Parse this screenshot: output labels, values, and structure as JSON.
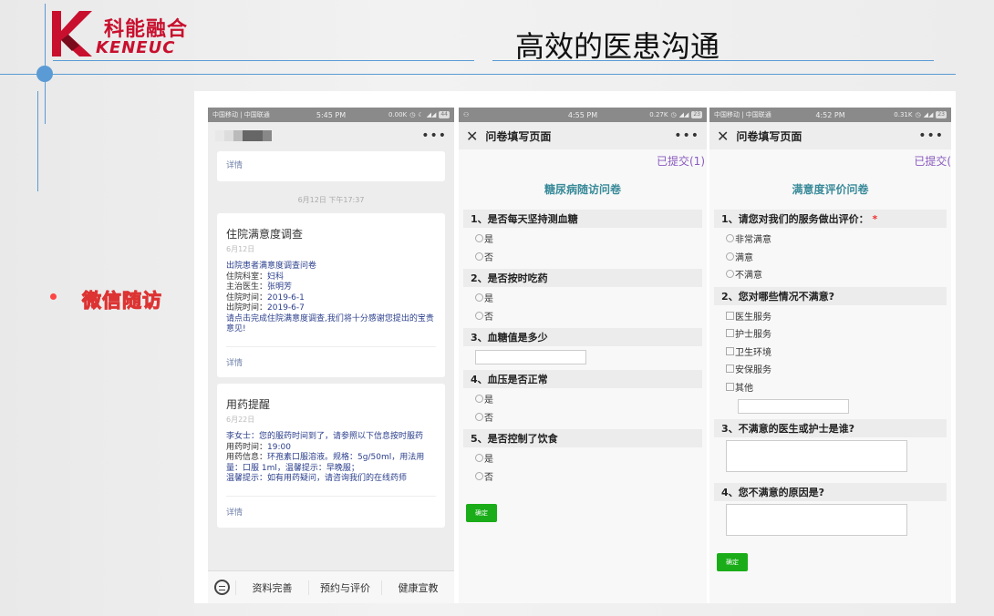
{
  "header": {
    "logo_cn": "科能融合",
    "logo_en": "KENEUC",
    "title": "高效的医患沟通"
  },
  "bullet": {
    "label": "微信随访"
  },
  "colors": {
    "accent_line": "#5b9bd5",
    "logo_red": "#c8102e",
    "submit_green": "#1aad19",
    "submitted_purple": "#8a5bbf",
    "survey_title": "#3a8b9a"
  },
  "phone1": {
    "status": {
      "carrier": "中国移动 | 中国联通",
      "time": "5:45 PM",
      "net": "0.00K",
      "battery": "44"
    },
    "more": "•••",
    "top_card": {
      "detail": "详情"
    },
    "chat_time": "6月12日 下午17:37",
    "survey_card": {
      "title": "住院满意度调查",
      "date": "6月12日",
      "lines": [
        {
          "label": "",
          "value": "出院患者满意度调查问卷"
        },
        {
          "label": "住院科室：",
          "value": "妇科"
        },
        {
          "label": "主治医生：",
          "value": "张明芳"
        },
        {
          "label": "住院时间：",
          "value": "2019-6-1"
        },
        {
          "label": "出院时间：",
          "value": "2019-6-7"
        },
        {
          "label": "",
          "value": "请点击完成住院满意度调查,我们将十分感谢您提出的宝贵意见!"
        }
      ],
      "detail": "详情"
    },
    "med_card": {
      "title": "用药提醒",
      "date": "6月22日",
      "lines": [
        {
          "label": "",
          "value": "李女士：您的服药时间到了，请参照以下信息按时服药"
        },
        {
          "label": "用药时间：",
          "value": "19:00"
        },
        {
          "label": "用药信息：",
          "value": "环孢素口服溶液。规格：5g/50ml，用法用量：口服 1ml，温馨提示：早晚服；"
        },
        {
          "label": "",
          "value": "温馨提示：如有用药疑问，请咨询我们的在线药师"
        }
      ],
      "detail": "详情"
    },
    "menu": [
      "资料完善",
      "预约与评价",
      "健康宣教"
    ]
  },
  "phone2": {
    "status": {
      "carrier": "",
      "time": "4:55 PM",
      "net": "0.27K",
      "battery": "23"
    },
    "nav_title": "问卷填写页面",
    "more": "•••",
    "submitted": "已提交(1)",
    "survey_title": "糖尿病随访问卷",
    "questions": [
      {
        "title": "1、是否每天坚持测血糖",
        "type": "radio",
        "options": [
          "是",
          "否"
        ]
      },
      {
        "title": "2、是否按时吃药",
        "type": "radio",
        "options": [
          "是",
          "否"
        ]
      },
      {
        "title": "3、血糖值是多少",
        "type": "input",
        "value": ""
      },
      {
        "title": "4、血压是否正常",
        "type": "radio",
        "options": [
          "是",
          "否"
        ]
      },
      {
        "title": "5、是否控制了饮食",
        "type": "radio",
        "options": [
          "是",
          "否"
        ]
      }
    ],
    "confirm": "确定"
  },
  "phone3": {
    "status": {
      "carrier": "中国移动 | 中国联通",
      "time": "4:52 PM",
      "net": "0.31K",
      "battery": "23"
    },
    "nav_title": "问卷填写页面",
    "more": "•••",
    "submitted": "已提交(",
    "survey_title": "满意度评价问卷",
    "questions": [
      {
        "title": "1、请您对我们的服务做出评价：",
        "required": "*",
        "type": "radio",
        "options": [
          "非常满意",
          "满意",
          "不满意"
        ]
      },
      {
        "title": "2、您对哪些情况不满意?",
        "type": "checkbox",
        "options": [
          "医生服务",
          "护士服务",
          "卫生环境",
          "安保服务",
          "其他"
        ]
      },
      {
        "title": "3、不满意的医生或护士是谁?",
        "type": "textarea",
        "value": ""
      },
      {
        "title": "4、您不满意的原因是?",
        "type": "textarea",
        "value": ""
      }
    ],
    "confirm": "确定"
  }
}
